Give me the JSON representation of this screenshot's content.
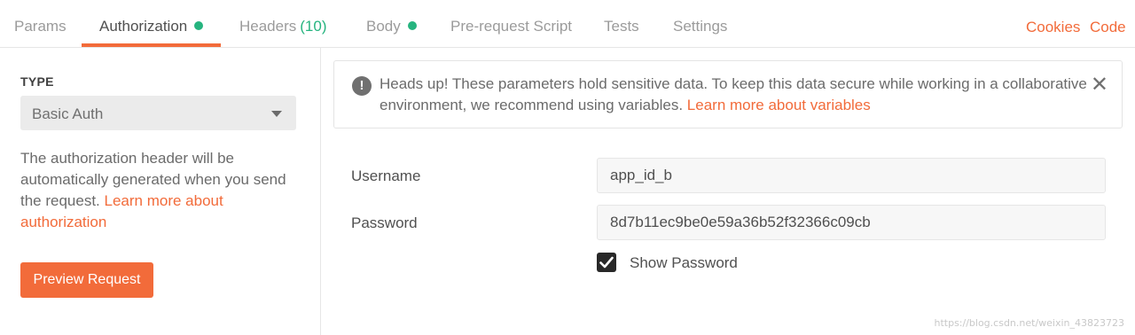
{
  "tabs": {
    "params": "Params",
    "authorization": "Authorization",
    "headers": "Headers",
    "headers_count": "(10)",
    "body": "Body",
    "prerequest": "Pre-request Script",
    "tests": "Tests",
    "settings": "Settings",
    "cookies": "Cookies",
    "code": "Code",
    "active": "Authorization"
  },
  "auth": {
    "type_label": "TYPE",
    "type_value": "Basic Auth",
    "description": "The authorization header will be automatically generated when you send the request.",
    "learn_more": "Learn more about authorization",
    "preview_button": "Preview Request"
  },
  "alert": {
    "icon": "!",
    "text": "Heads up! These parameters hold sensitive data. To keep this data secure while working in a collaborative environment, we recommend using variables.",
    "link": "Learn more about variables",
    "close": "✕"
  },
  "form": {
    "username_label": "Username",
    "username_value": "app_id_b",
    "password_label": "Password",
    "password_value": "8d7b11ec9be0e59a36b52f32366c09cb",
    "show_password_label": "Show Password",
    "show_password_checked": true
  },
  "watermark": "https://blog.csdn.net/weixin_43823723",
  "colors": {
    "accent": "#f26b3a",
    "status_green": "#26b47f"
  }
}
